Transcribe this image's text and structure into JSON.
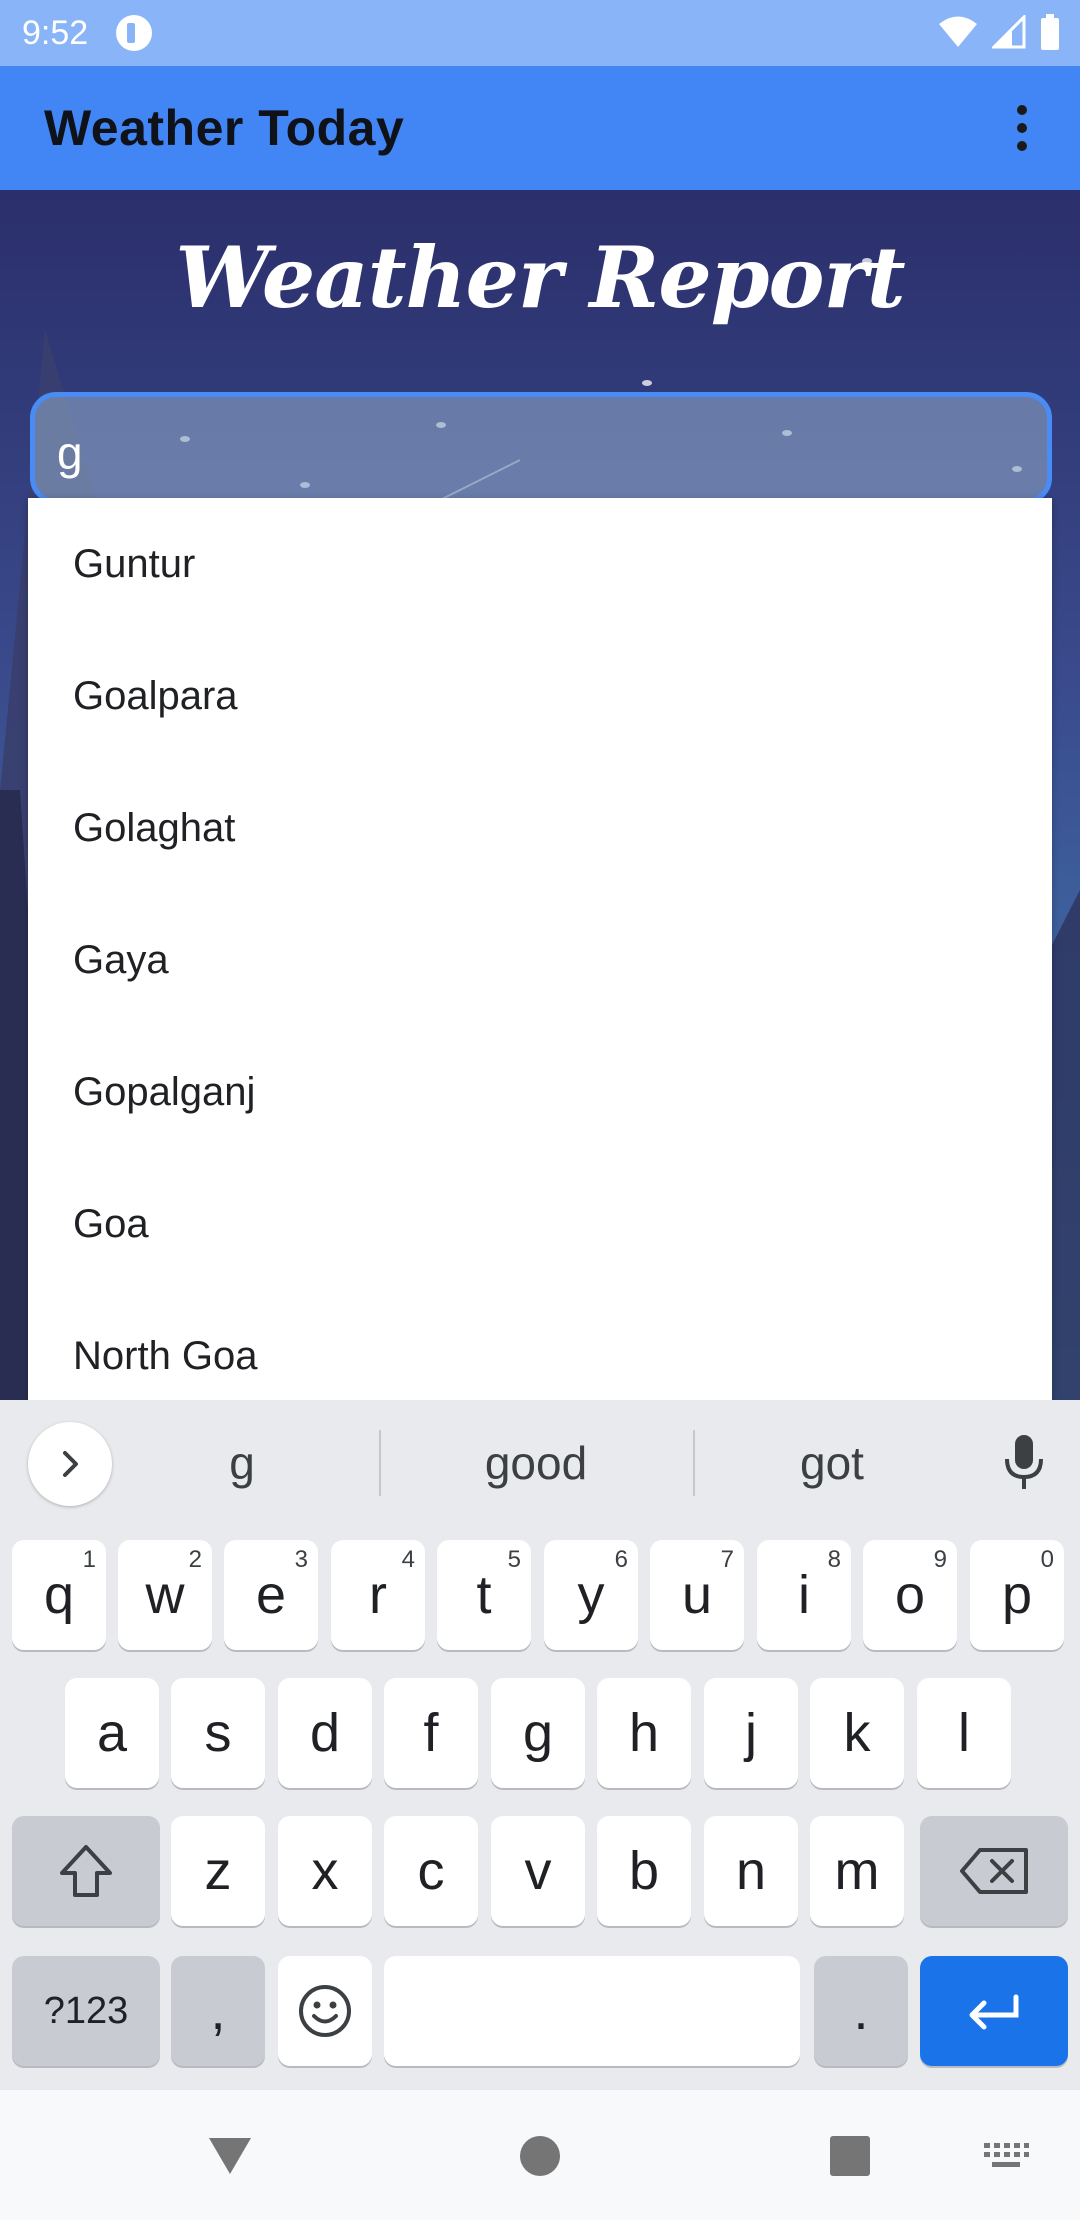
{
  "status_bar": {
    "time": "9:52",
    "icons": [
      "app-icon",
      "wifi-icon",
      "cellular-icon",
      "battery-icon"
    ]
  },
  "app_bar": {
    "title": "Weather Today",
    "menu_icon": "overflow-menu-icon"
  },
  "header": {
    "title": "Weather Report"
  },
  "search": {
    "value": "g",
    "placeholder": ""
  },
  "dropdown": {
    "items": [
      "Guntur",
      "Goalpara",
      "Golaghat",
      "Gaya",
      "Gopalganj",
      "Goa",
      "North Goa"
    ]
  },
  "keyboard": {
    "suggestions": [
      "g",
      "good",
      "got"
    ],
    "row1": [
      {
        "key": "q",
        "hint": "1"
      },
      {
        "key": "w",
        "hint": "2"
      },
      {
        "key": "e",
        "hint": "3"
      },
      {
        "key": "r",
        "hint": "4"
      },
      {
        "key": "t",
        "hint": "5"
      },
      {
        "key": "y",
        "hint": "6"
      },
      {
        "key": "u",
        "hint": "7"
      },
      {
        "key": "i",
        "hint": "8"
      },
      {
        "key": "o",
        "hint": "9"
      },
      {
        "key": "p",
        "hint": "0"
      }
    ],
    "row2": [
      "a",
      "s",
      "d",
      "f",
      "g",
      "h",
      "j",
      "k",
      "l"
    ],
    "row3": [
      "z",
      "x",
      "c",
      "v",
      "b",
      "n",
      "m"
    ],
    "row4": {
      "symbols": "?123",
      "comma": ",",
      "period": "."
    },
    "colors": {
      "background": "#e8eaed",
      "key": "#ffffff",
      "function_key": "#c8ccd2",
      "enter": "#1a73e8"
    }
  },
  "colors": {
    "status_bar": "#8ab4f8",
    "app_bar": "#4285f4",
    "field_border": "#4a8cf5"
  }
}
